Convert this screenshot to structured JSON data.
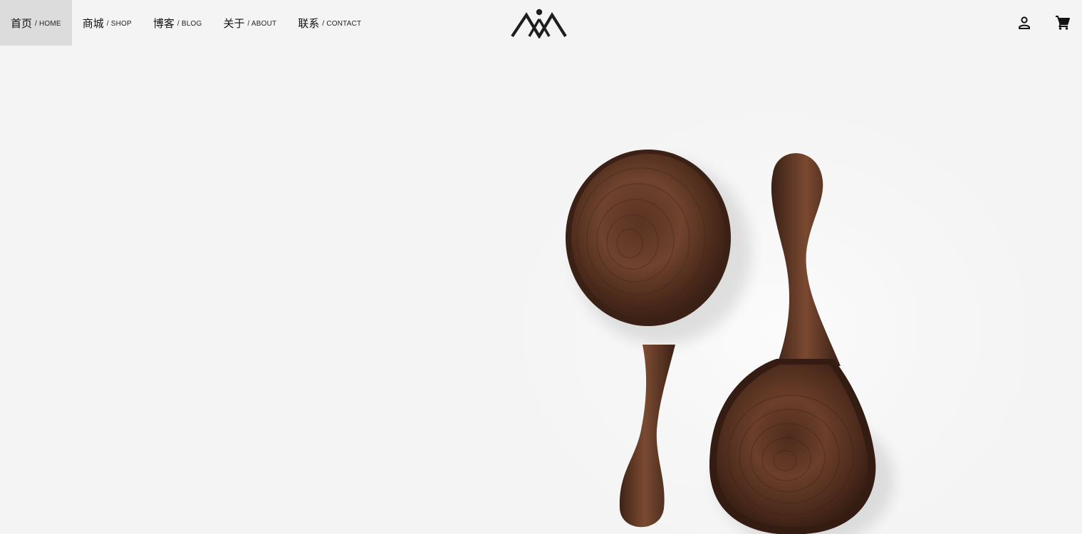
{
  "nav": {
    "items": [
      {
        "cn": "首页",
        "en": "/ HOME",
        "active": true
      },
      {
        "cn": "商城",
        "en": "/ SHOP",
        "active": false
      },
      {
        "cn": "博客",
        "en": "/ BLOG",
        "active": false
      },
      {
        "cn": "关于",
        "en": "/ ABOUT",
        "active": false
      },
      {
        "cn": "联系",
        "en": "/ CONTACT",
        "active": false
      }
    ]
  },
  "icons": {
    "logo": "brand-logo",
    "account": "account-icon",
    "cart": "shopping-cart-icon"
  },
  "hero": {
    "image": "two-wooden-scoops-photo"
  },
  "colors": {
    "background": "#f4f4f4",
    "active_nav": "#dcdcdc",
    "text": "#111111",
    "wood_dark": "#3b2317",
    "wood_mid": "#6a3f2a"
  }
}
